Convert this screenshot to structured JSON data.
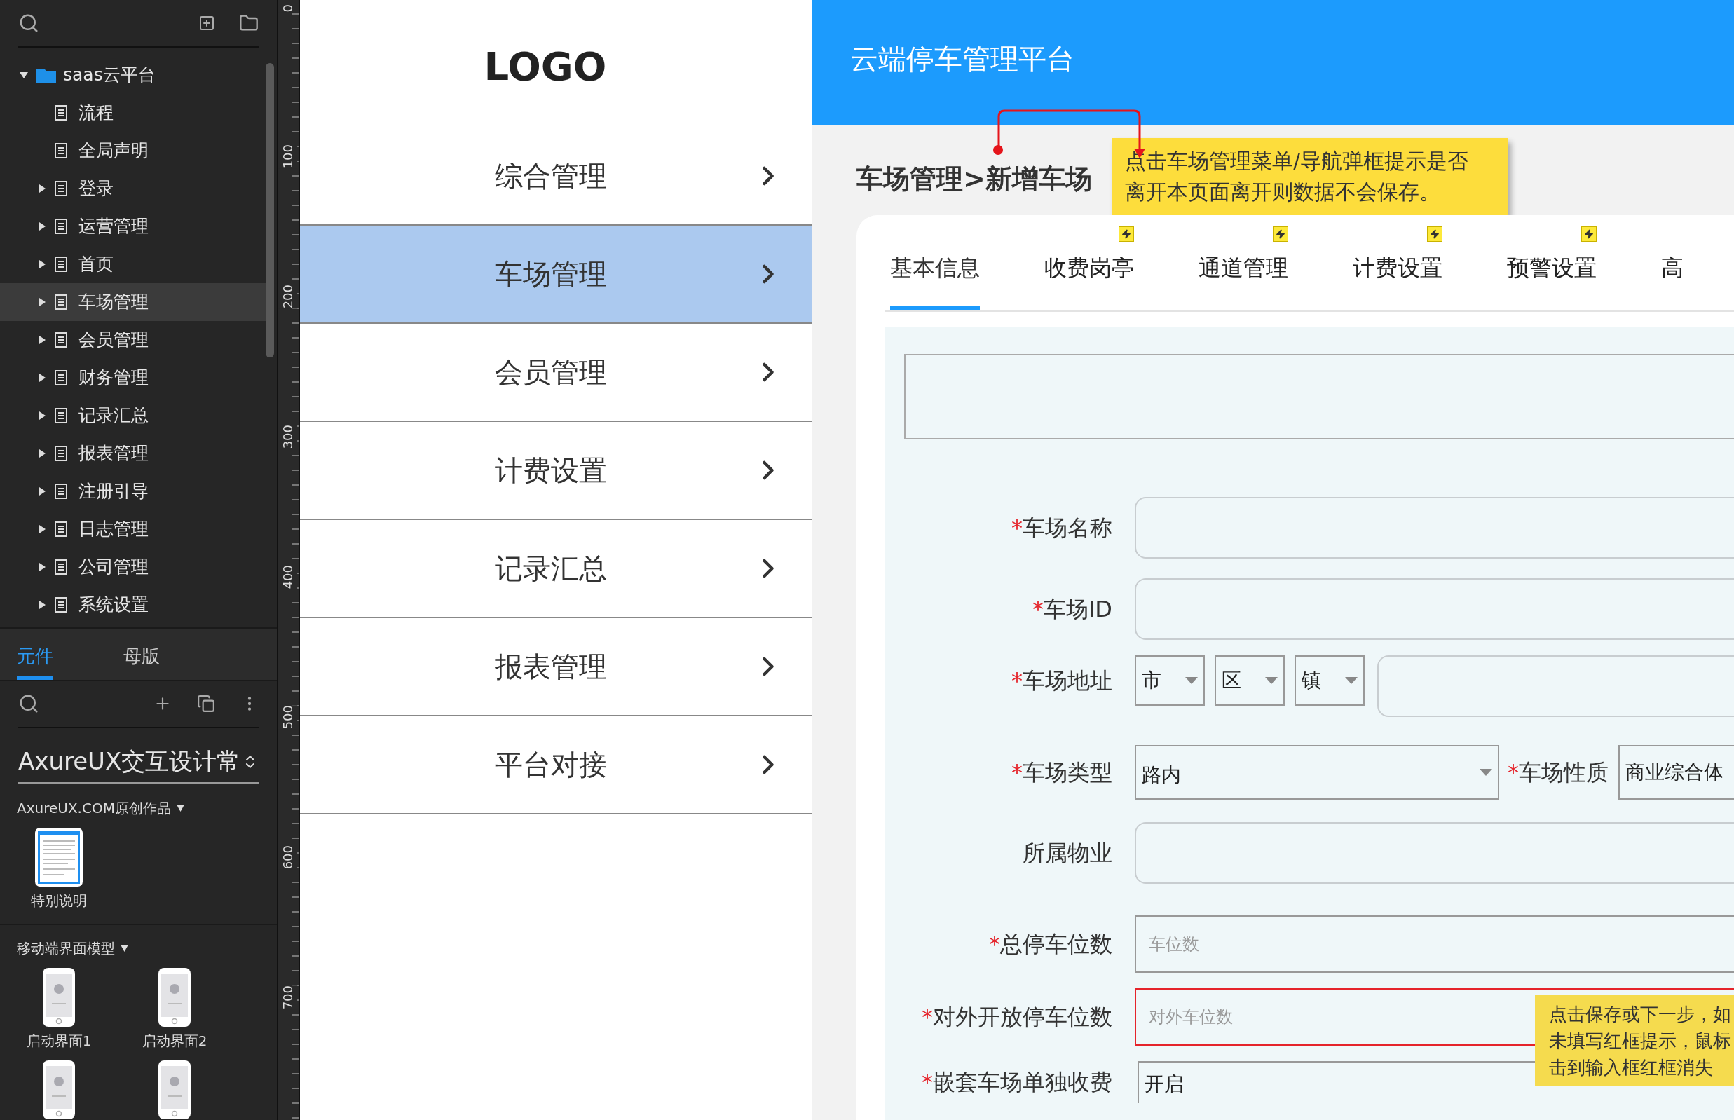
{
  "sidebar": {
    "pages": [
      {
        "label": "saas云平台",
        "kind": "folder",
        "expandable": true,
        "expanded": true,
        "selected": false,
        "children": [
          {
            "label": "流程",
            "kind": "page",
            "expandable": false,
            "expanded": false,
            "selected": false
          },
          {
            "label": "全局声明",
            "kind": "page",
            "expandable": false,
            "expanded": false,
            "selected": false
          },
          {
            "label": "登录",
            "kind": "page",
            "expandable": true,
            "expanded": false,
            "selected": false
          },
          {
            "label": "运营管理",
            "kind": "page",
            "expandable": true,
            "expanded": false,
            "selected": false
          },
          {
            "label": "首页",
            "kind": "page",
            "expandable": true,
            "expanded": false,
            "selected": false
          },
          {
            "label": "车场管理",
            "kind": "page",
            "expandable": true,
            "expanded": false,
            "selected": true
          },
          {
            "label": "会员管理",
            "kind": "page",
            "expandable": true,
            "expanded": false,
            "selected": false
          },
          {
            "label": "财务管理",
            "kind": "page",
            "expandable": true,
            "expanded": false,
            "selected": false
          },
          {
            "label": "记录汇总",
            "kind": "page",
            "expandable": true,
            "expanded": false,
            "selected": false
          },
          {
            "label": "报表管理",
            "kind": "page",
            "expandable": true,
            "expanded": false,
            "selected": false
          },
          {
            "label": "注册引导",
            "kind": "page",
            "expandable": true,
            "expanded": false,
            "selected": false
          },
          {
            "label": "日志管理",
            "kind": "page",
            "expandable": true,
            "expanded": false,
            "selected": false
          },
          {
            "label": "公司管理",
            "kind": "page",
            "expandable": true,
            "expanded": false,
            "selected": false
          },
          {
            "label": "系统设置",
            "kind": "page",
            "expandable": true,
            "expanded": false,
            "selected": false
          }
        ]
      }
    ],
    "library_tabs": [
      {
        "label": "元件",
        "selected": true
      },
      {
        "label": "母版",
        "selected": false
      }
    ],
    "library_name": "AxureUX交互设计常",
    "groups": [
      {
        "title": "AxureUX.COM原创作品",
        "items": [
          {
            "label": "特别说明",
            "kind": "document"
          }
        ]
      },
      {
        "title": "移动端界面模型",
        "items": [
          {
            "label": "启动界面1",
            "kind": "phone"
          },
          {
            "label": "启动界面2",
            "kind": "phone"
          },
          {
            "kind": "phone"
          },
          {
            "kind": "phone"
          }
        ]
      }
    ]
  },
  "ruler": {
    "marks": [
      "0",
      "100",
      "200",
      "300",
      "400",
      "500",
      "600",
      "700"
    ]
  },
  "menu_panel": {
    "logo": "LOGO",
    "items": [
      {
        "label": "综合管理",
        "selected": false
      },
      {
        "label": "车场管理",
        "selected": true
      },
      {
        "label": "会员管理",
        "selected": false
      },
      {
        "label": "计费设置",
        "selected": false
      },
      {
        "label": "记录汇总",
        "selected": false
      },
      {
        "label": "报表管理",
        "selected": false
      },
      {
        "label": "平台对接",
        "selected": false
      }
    ]
  },
  "page": {
    "title": "云端停车管理平台",
    "breadcrumb": "车场管理>新增车场",
    "note": [
      "点击车场管理菜单/导航弹框提示是否",
      "离开本页面离开则数据不会保存。"
    ],
    "tabs": [
      {
        "label": "基本信息",
        "selected": true,
        "flagged": false
      },
      {
        "label": "收费岗亭",
        "selected": false,
        "flagged": true
      },
      {
        "label": "通道管理",
        "selected": false,
        "flagged": true
      },
      {
        "label": "计费设置",
        "selected": false,
        "flagged": true
      },
      {
        "label": "预警设置",
        "selected": false,
        "flagged": true
      },
      {
        "label": "高",
        "selected": false,
        "flagged": false
      }
    ],
    "form": [
      {
        "kind": "input",
        "mark": "*",
        "label": "车场名称",
        "error": false
      },
      {
        "kind": "input",
        "mark": "*",
        "label": "车场ID",
        "error": false
      },
      {
        "kind": "address",
        "mark": "*",
        "label": "车场地址",
        "selects": [
          "市",
          "区",
          "镇"
        ]
      },
      {
        "kind": "select_pair",
        "mark": "*",
        "label": "车场类型",
        "value": "路内",
        "mark_2": "*",
        "label_2": "车场性质",
        "value_2": "商业综合体"
      },
      {
        "kind": "input",
        "label": "所属物业",
        "error": false
      },
      {
        "kind": "box",
        "mark": "*",
        "label": "总停车位数",
        "placeholder": "车位数",
        "error": false
      },
      {
        "kind": "box",
        "mark": "*",
        "label": "对外开放停车位数",
        "placeholder": "对外车位数",
        "error": true
      },
      {
        "kind": "value",
        "mark": "*",
        "label": "嵌套车场单独收费",
        "value": "开启"
      }
    ],
    "note_2": [
      "点击保存或下一步，如",
      "未填写红框提示，鼠标",
      "击到输入框红框消失"
    ]
  }
}
